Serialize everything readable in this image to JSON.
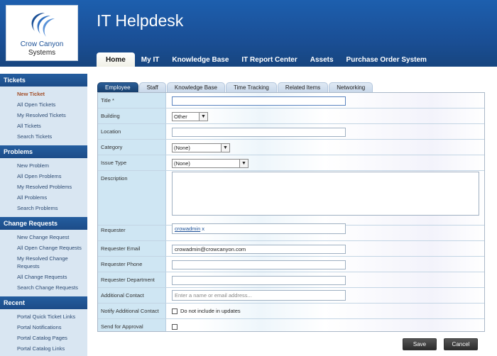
{
  "logo": {
    "line1": "Crow Canyon",
    "line2": "Systems"
  },
  "site_title": "IT Helpdesk",
  "topnav": [
    "Home",
    "My IT",
    "Knowledge Base",
    "IT Report Center",
    "Assets",
    "Purchase Order System"
  ],
  "sidebar": {
    "tickets": {
      "title": "Tickets",
      "links": [
        "New Ticket",
        "All Open Tickets",
        "My Resolved Tickets",
        "All Tickets",
        "Search Tickets"
      ]
    },
    "problems": {
      "title": "Problems",
      "links": [
        "New Problem",
        "All Open Problems",
        "My Resolved Problems",
        "All Problems",
        "Search Problems"
      ]
    },
    "changes": {
      "title": "Change Requests",
      "links": [
        "New Change Request",
        "All Open Change Requests",
        "My Resolved Change Requests",
        "All Change Requests",
        "Search Change Requests"
      ]
    },
    "recent": {
      "title": "Recent",
      "links": [
        "Portal Quick Ticket Links",
        "Portal Notifications",
        "Portal Catalog Pages",
        "Portal Catalog Links"
      ]
    }
  },
  "tabs": [
    "Employee",
    "Staff",
    "Knowledge Base",
    "Time Tracking",
    "Related Items",
    "Networking"
  ],
  "form": {
    "title_label": "Title *",
    "building_label": "Building",
    "building_value": "Other",
    "location_label": "Location",
    "category_label": "Category",
    "category_value": "(None)",
    "issue_type_label": "Issue Type",
    "issue_type_value": "(None)",
    "description_label": "Description",
    "requester_label": "Requester",
    "requester_value": "crowadmin",
    "requester_remove": "x",
    "requester_email_label": "Requester Email",
    "requester_email_value": "crowadmin@crowcanyon.com",
    "requester_phone_label": "Requester Phone",
    "requester_department_label": "Requester Department",
    "additional_contact_label": "Additional Contact",
    "additional_contact_placeholder": "Enter a name or email address...",
    "notify_label": "Notify Additional Contact",
    "notify_checkbox_label": "Do not include in updates",
    "approval_label": "Send for Approval"
  },
  "buttons": {
    "save": "Save",
    "cancel": "Cancel"
  },
  "colors": {
    "header": "#1a4f96",
    "sidebar": "#d9e6f2",
    "active_tab": "#1f4b7d",
    "current_link": "#a3502a"
  }
}
